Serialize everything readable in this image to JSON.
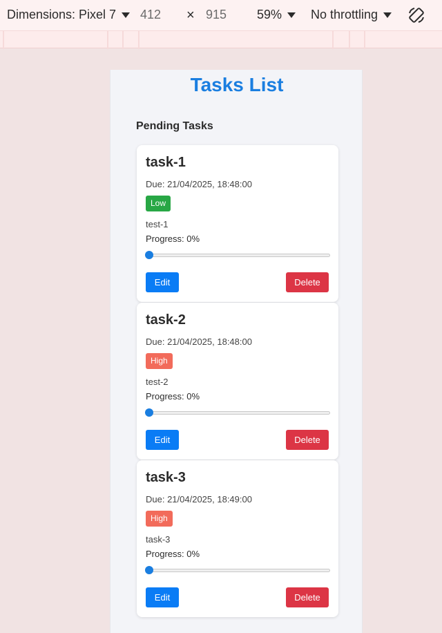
{
  "devtools": {
    "device_label": "Dimensions: Pixel 7",
    "width": "412",
    "times": "×",
    "height": "915",
    "zoom": "59%",
    "throttle": "No throttling",
    "rotate_icon": "rotate-icon"
  },
  "app": {
    "title": "Tasks List",
    "section": "Pending Tasks",
    "colors": {
      "title": "#1a7ee0",
      "low": "#28a745",
      "high": "#f26b5b",
      "edit": "#0a7cf5",
      "delete": "#dc3545"
    }
  },
  "tasks": [
    {
      "name": "task-1",
      "due": "Due: 21/04/2025, 18:48:00",
      "priority": "Low",
      "description": "test-1",
      "progress_text": "Progress: 0%",
      "progress": 0,
      "edit_label": "Edit",
      "delete_label": "Delete"
    },
    {
      "name": "task-2",
      "due": "Due: 21/04/2025, 18:48:00",
      "priority": "High",
      "description": "test-2",
      "progress_text": "Progress: 0%",
      "progress": 0,
      "edit_label": "Edit",
      "delete_label": "Delete"
    },
    {
      "name": "task-3",
      "due": "Due: 21/04/2025, 18:49:00",
      "priority": "High",
      "description": "task-3",
      "progress_text": "Progress: 0%",
      "progress": 0,
      "edit_label": "Edit",
      "delete_label": "Delete"
    }
  ]
}
